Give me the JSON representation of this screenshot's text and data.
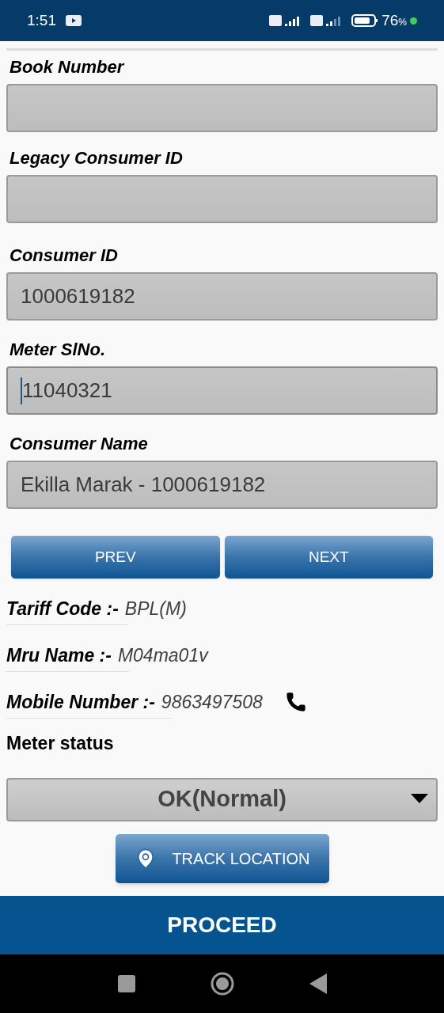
{
  "status_bar": {
    "time": "1:51",
    "battery": "76",
    "battery_unit": "%"
  },
  "fields": [
    {
      "label": "Book Number",
      "focused": false
    },
    {
      "label": "Legacy Consumer ID",
      "focused": false
    },
    {
      "label": "Consumer ID",
      "value": "1000619182",
      "focused": false
    },
    {
      "label": "Meter SlNo.",
      "value": "11040321",
      "focused": true
    },
    {
      "label": "Consumer Name",
      "value": "Ekilla Marak - 1000619182",
      "focused": false
    }
  ],
  "nav_buttons": [
    "PREV",
    "NEXT"
  ],
  "info": [
    {
      "label": "Tariff Code :-",
      "value": "BPL(M)",
      "kind": "text"
    },
    {
      "label": "Mru Name :-",
      "value": "M04ma01v",
      "kind": "text"
    },
    {
      "label": "Mobile Number :-",
      "value": "9863497508",
      "kind": "phone"
    }
  ],
  "meter_status": {
    "label": "Meter status",
    "value": "OK(Normal)"
  },
  "track_button": "TRACK LOCATION",
  "proceed_button": "PROCEED"
}
